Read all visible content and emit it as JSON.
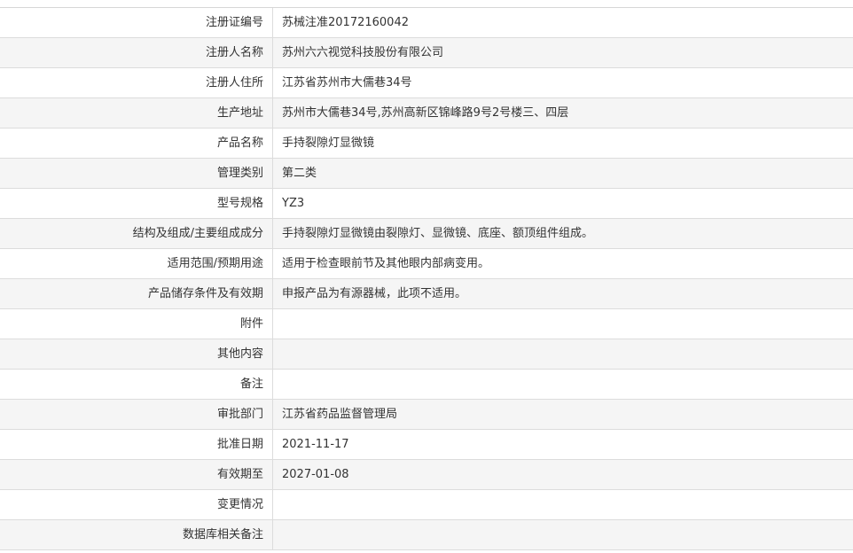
{
  "rows": [
    {
      "label": "注册证编号",
      "value": "苏械注准20172160042"
    },
    {
      "label": "注册人名称",
      "value": "苏州六六视觉科技股份有限公司"
    },
    {
      "label": "注册人住所",
      "value": "江苏省苏州市大儒巷34号"
    },
    {
      "label": "生产地址",
      "value": "苏州市大儒巷34号,苏州高新区锦峰路9号2号楼三、四层"
    },
    {
      "label": "产品名称",
      "value": "手持裂隙灯显微镜"
    },
    {
      "label": "管理类别",
      "value": "第二类"
    },
    {
      "label": "型号规格",
      "value": "YZ3"
    },
    {
      "label": "结构及组成/主要组成成分",
      "value": "手持裂隙灯显微镜由裂隙灯、显微镜、底座、额顶组件组成。"
    },
    {
      "label": "适用范围/预期用途",
      "value": "适用于检查眼前节及其他眼内部病变用。"
    },
    {
      "label": "产品储存条件及有效期",
      "value": "申报产品为有源器械，此项不适用。"
    },
    {
      "label": "附件",
      "value": ""
    },
    {
      "label": "其他内容",
      "value": ""
    },
    {
      "label": "备注",
      "value": ""
    },
    {
      "label": "审批部门",
      "value": "江苏省药品监督管理局"
    },
    {
      "label": "批准日期",
      "value": "2021-11-17"
    },
    {
      "label": "有效期至",
      "value": "2027-01-08"
    },
    {
      "label": "变更情况",
      "value": ""
    },
    {
      "label": "数据库相关备注",
      "value": ""
    }
  ]
}
